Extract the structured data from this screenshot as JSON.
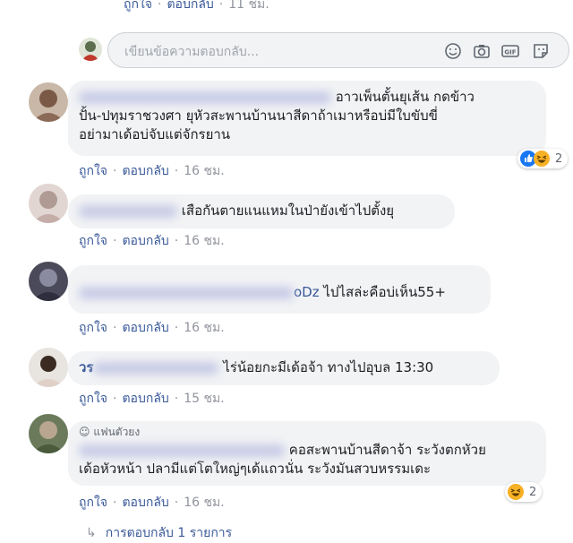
{
  "actions": {
    "like": "ถูกใจ",
    "reply": "ตอบกลับ",
    "separator": "·"
  },
  "top_row": {
    "time": "11 ชม."
  },
  "composer": {
    "placeholder": "เขียนข้อความตอบกลับ..."
  },
  "comments": [
    {
      "text": "อาวเพ็นตั้นยุเส้น กดข้าวปั้น-ปทุมราชวงศา ยุหัวสะพานบ้านนาสีดาถ้าเมาหรือบ่มีใบขับขี่ อย่ามาเด้อบ่จับแต่จักรยาน",
      "text_line1": "อาวเพ็นตั้นยุเส้น กดข้าว",
      "text_line2": "ปั้น-ปทุมราชวงศา ยุหัวสะพานบ้านนาสีดาถ้าเมาหรือบ่มีใบขับขี่",
      "text_line3": "อย่ามาเด้อบ่จับแต่จักรยาน",
      "time": "16 ชม.",
      "reaction_count": "2"
    },
    {
      "text": "เสือกันตายแนแหมในป่ายังเข้าไปตั้งยุ",
      "time": "16 ชม."
    },
    {
      "name_suffix": "oDz",
      "text": "ไปไสล่ะคือบ่เห็น55+",
      "time": "16 ชม."
    },
    {
      "name_prefix": "วร",
      "text": "ไร่น้อยกะมีเด้อจ้า ทางไปอุบล 13:30",
      "time": "15 ชม."
    },
    {
      "badge": "แฟนตัวยง",
      "text_line1": "คอสะพานบ้านสีดาจ้า ระวังตกหัวย",
      "text_line2": "เด้อหัวหน้า ปลามีแต่โตใหญ่ๆเด้แถวนั่น ระวังมันสวบหรรมเดะ",
      "time": "16 ชม.",
      "reaction_count": "2"
    }
  ],
  "replies_link": "การตอบกลับ 1 รายการ",
  "colors": {
    "link": "#385898",
    "bubble": "#f2f3f5",
    "muted": "#90949c",
    "like_blue": "#1877f2",
    "haha_yellow": "#f7b125"
  }
}
